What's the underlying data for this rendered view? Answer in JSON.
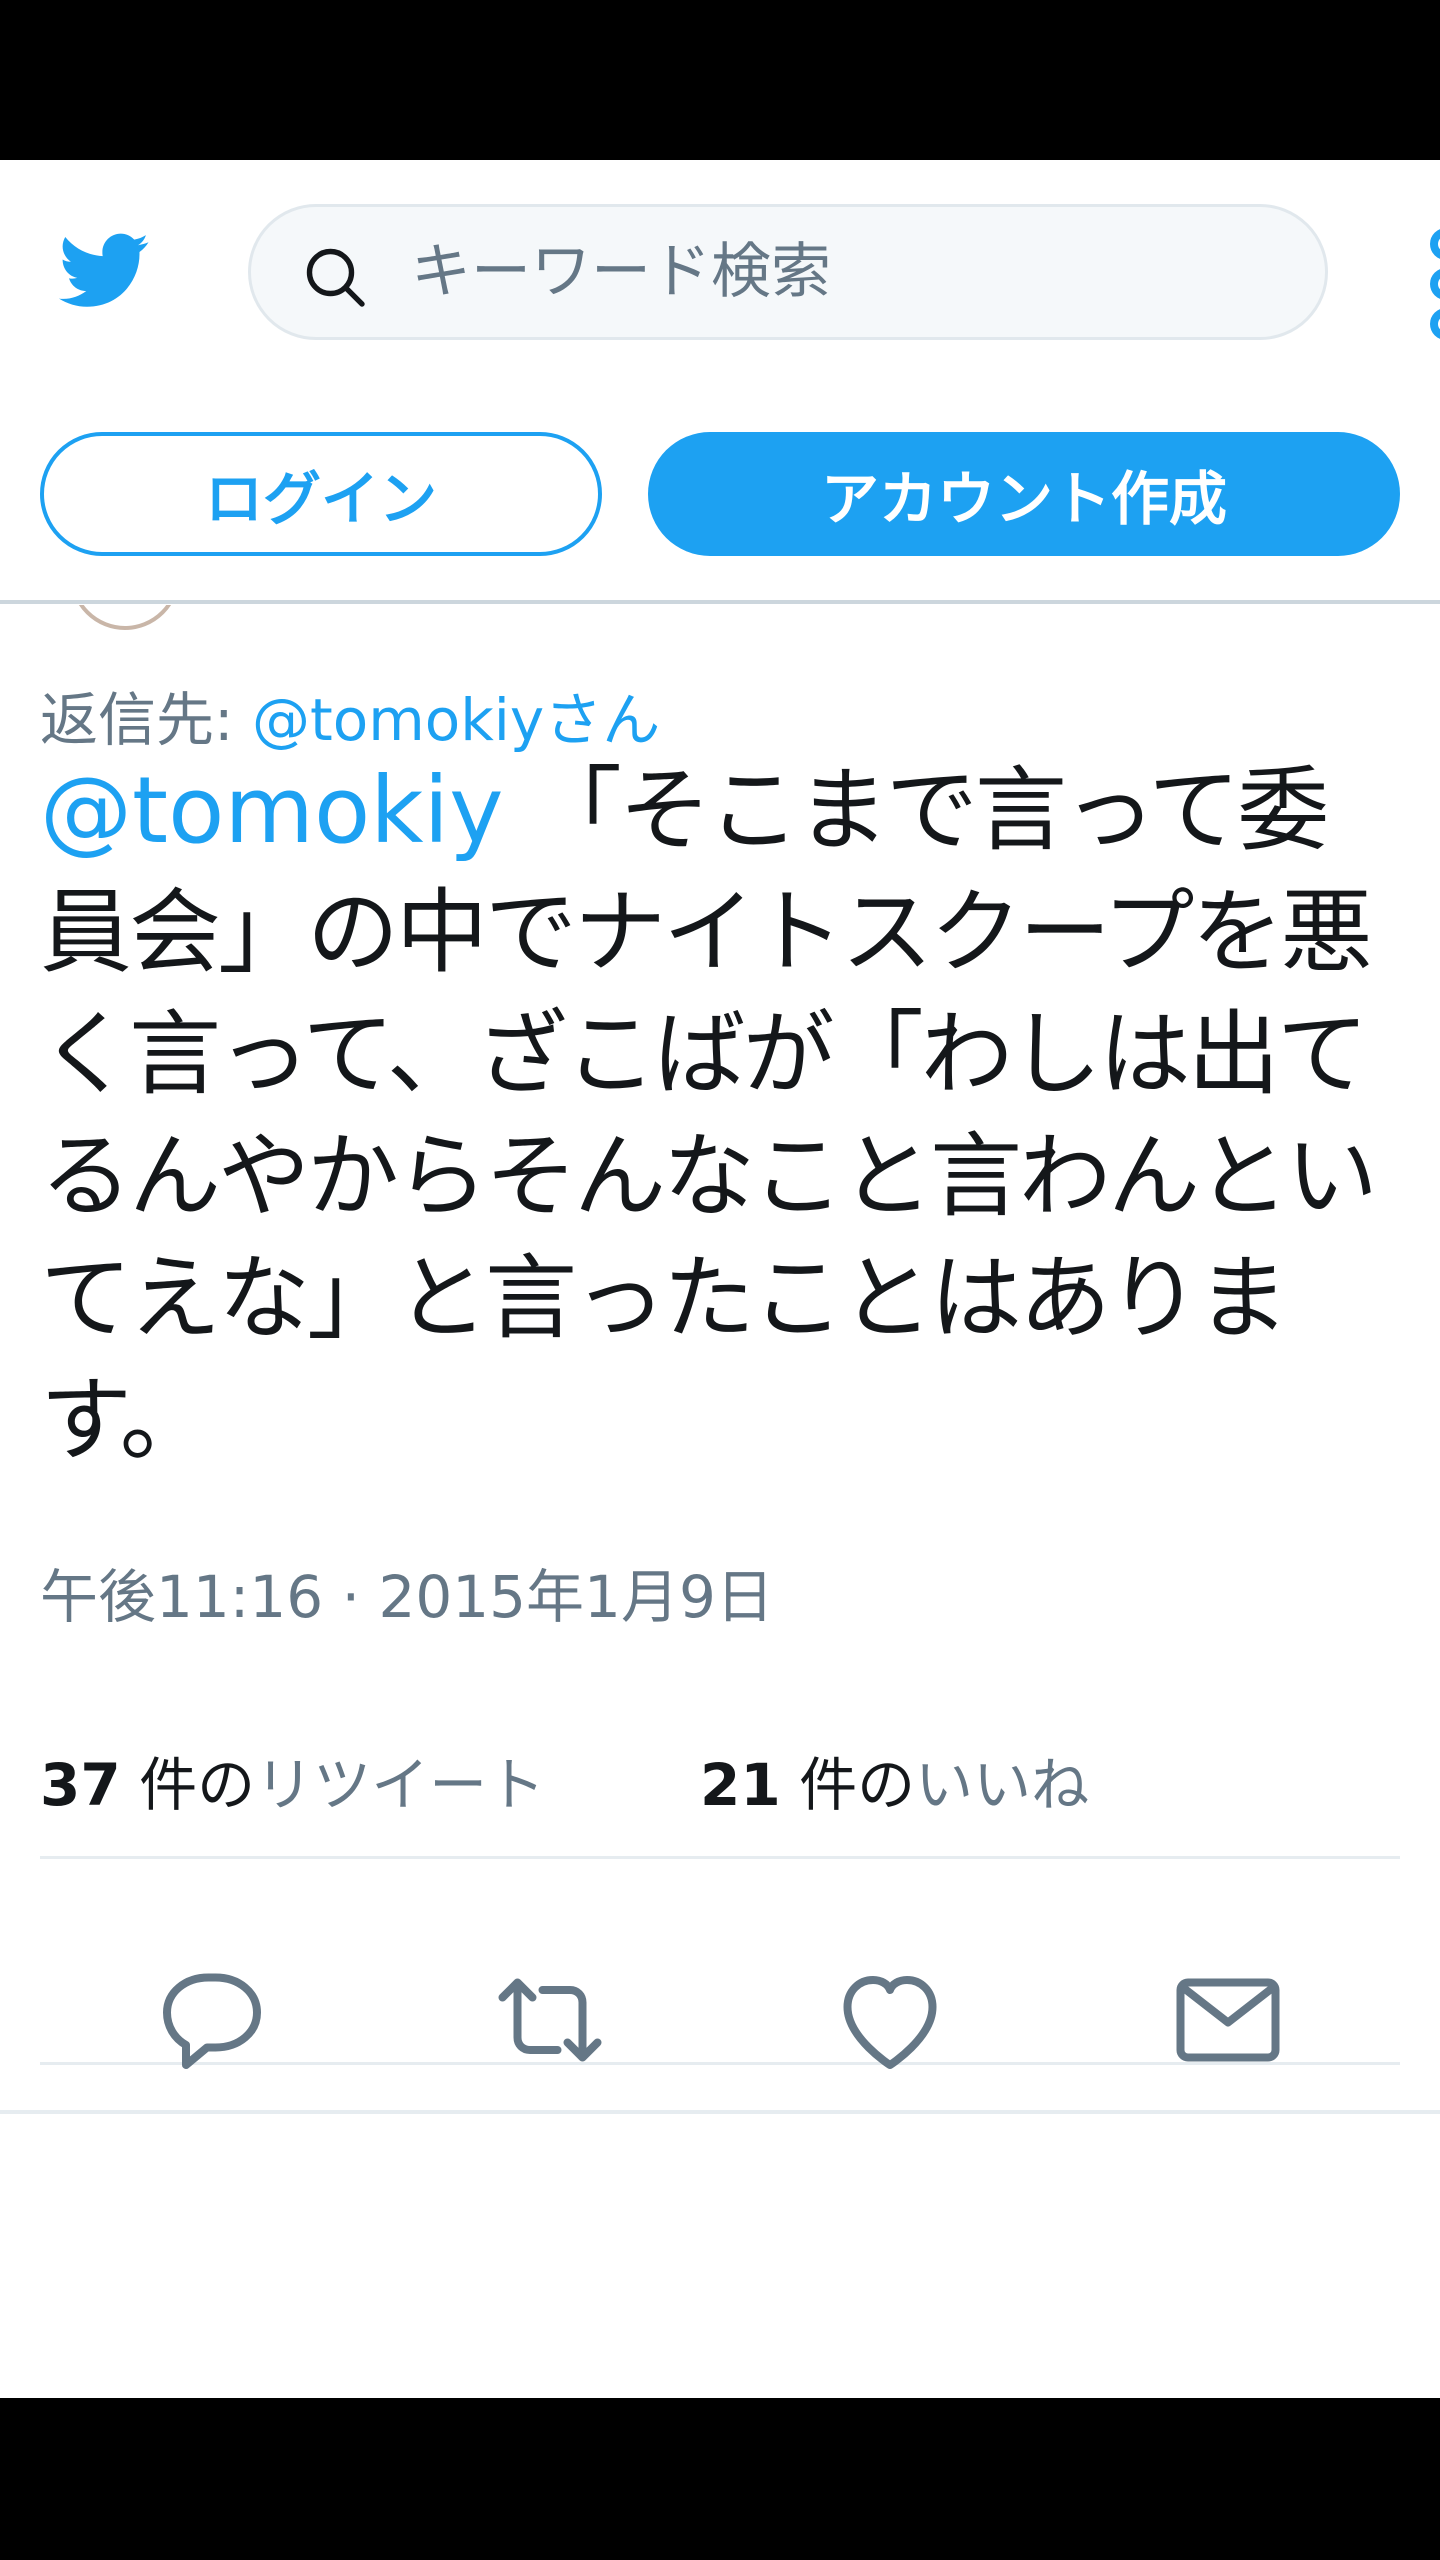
{
  "search": {
    "placeholder": "キーワード検索"
  },
  "auth": {
    "login_label": "ログイン",
    "signup_label": "アカウント作成"
  },
  "tweet": {
    "reply_prefix": "返信先: ",
    "reply_to": "@tomokiy",
    "reply_suffix": "さん",
    "mention": "@tomokiy",
    "text": "「そこまで言って委員会」の中でナイトスクープを悪く言って、ざこばが「わしは出てるんやからそんなこと言わんといてえな」と言ったことはあります。",
    "timestamp": "午後11:16 · 2015年1月9日",
    "retweets": {
      "count": "37",
      "unit": " 件の",
      "label": "リツイート"
    },
    "likes": {
      "count": "21",
      "unit": " 件の",
      "label": "いいね"
    }
  },
  "icons": {
    "logo": "twitter-bird-icon",
    "search": "search-icon",
    "more": "more-icon",
    "reply": "reply-icon",
    "retweet": "retweet-icon",
    "like": "heart-icon",
    "dm": "envelope-icon"
  },
  "colors": {
    "brand": "#1da1f2",
    "secondary_text": "#657786",
    "primary_text": "#14171a",
    "action_icon": "#657786"
  }
}
